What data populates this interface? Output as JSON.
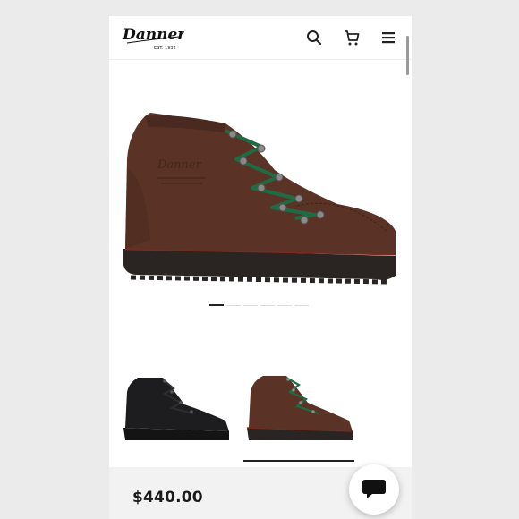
{
  "header": {
    "brand": "Danner",
    "est": "EST. 1932",
    "icons": [
      "search-icon",
      "cart-icon",
      "menu-icon"
    ]
  },
  "gallery": {
    "slide_count": 6,
    "active_slide": 1,
    "thumbnails": [
      {
        "variant": "black",
        "selected": false
      },
      {
        "variant": "brown",
        "selected": true
      }
    ]
  },
  "product": {
    "price": "$440.00"
  },
  "chat": {
    "icon": "chat-bubble-icon"
  },
  "colors": {
    "leather_brown": "#5a3326",
    "lace_green": "#1f6b43",
    "sole": "#2a2523",
    "black_leather": "#1d1d1f"
  }
}
